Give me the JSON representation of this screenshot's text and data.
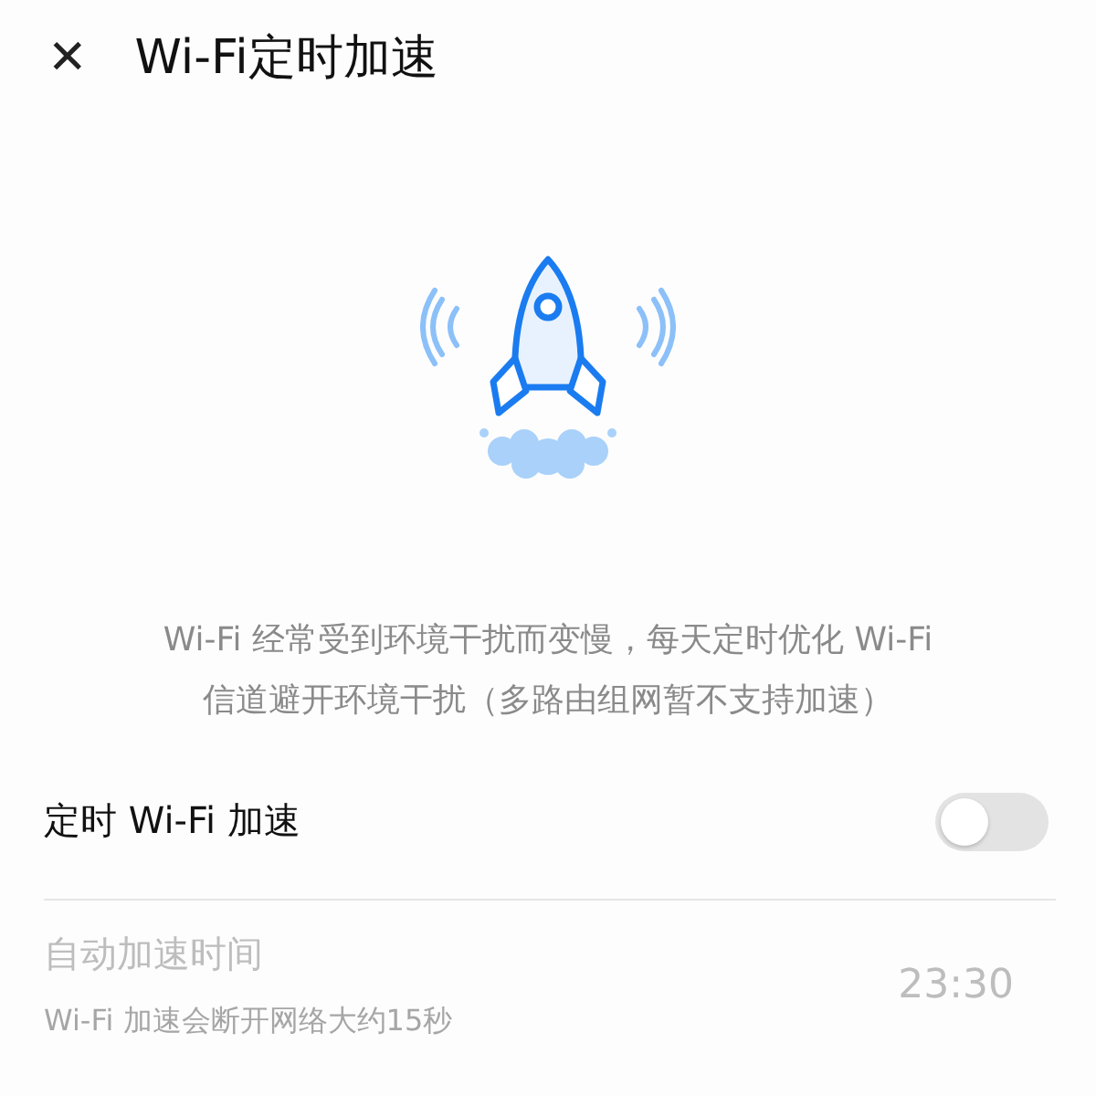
{
  "header": {
    "close_glyph": "✕",
    "title": "Wi-Fi定时加速"
  },
  "description": "Wi-Fi 经常受到环境干扰而变慢，每天定时优化 Wi-Fi 信道避开环境干扰（多路由组网暂不支持加速）",
  "toggle": {
    "label": "定时 Wi-Fi 加速",
    "on": false
  },
  "auto_time": {
    "label": "自动加速时间",
    "hint": "Wi-Fi 加速会断开网络大约15秒",
    "value": "23:30",
    "disabled": true
  }
}
